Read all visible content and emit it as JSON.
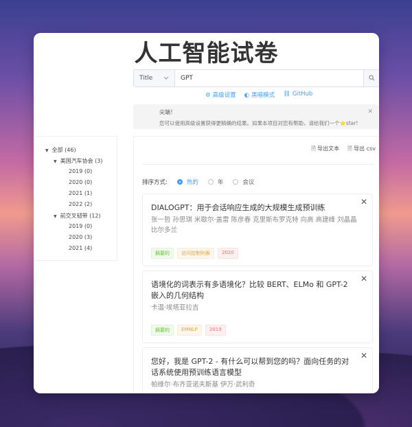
{
  "page": {
    "title": "人工智能试卷"
  },
  "search": {
    "field_label": "Title",
    "value": "GPT"
  },
  "links": {
    "advanced": "高级设置",
    "dark_mode": "黑暗模式",
    "github": "GitHub"
  },
  "notice": {
    "title": "尖端！",
    "text": "您可以使用高级设置获得更精确的结果。如果本项目对您有帮助，请给我们一个⭐star!"
  },
  "tree": {
    "root": "全部 (46)",
    "groups": [
      {
        "label": "美国汽车协会 (3)",
        "years": [
          "2019 (0)",
          "2020 (0)",
          "2021 (1)",
          "2022 (2)"
        ]
      },
      {
        "label": "前交叉韧带 (12)",
        "years": [
          "2019 (0)",
          "2020 (3)",
          "2021 (4)"
        ]
      }
    ]
  },
  "exports": {
    "text": "导出文本",
    "csv": "导出 csv"
  },
  "sort": {
    "label": "排序方式:",
    "options": [
      "热的",
      "年",
      "会议"
    ]
  },
  "papers": [
    {
      "title": "DIALOGPT：用于会话响应生成的大规模生成预训练",
      "authors": "张一哲  孙思琪  米歇尔·盖雷  陈彦春  克里斯布罗克特  向高  高建峰  刘晶晶  比尔多兰",
      "tags": [
        "摘要的",
        "访问控制列表",
        "2020"
      ]
    },
    {
      "title": "语境化的词表示有多语境化？比较 BERT、ELMo 和 GPT-2 嵌入的几何结构",
      "authors": "卡温·埃塔亚拉吉",
      "tags": [
        "摘要的",
        "EMNLP",
        "2019"
      ]
    },
    {
      "title": "您好，我是 GPT-2 - 有什么可以帮到您的吗？面向任务的对话系统使用预训练语言模型",
      "authors": "帕维尔·布齐亚诺夫斯基  伊万·武利奇",
      "tags": []
    }
  ]
}
